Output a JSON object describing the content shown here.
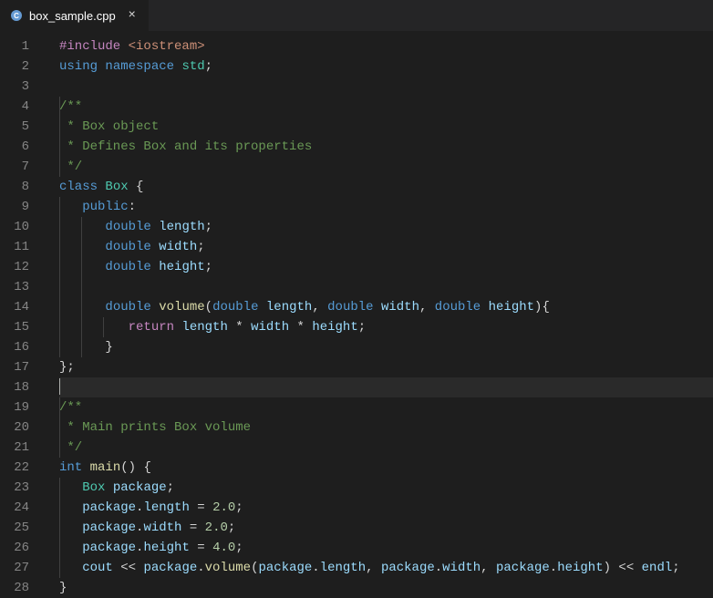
{
  "tab": {
    "filename": "box_sample.cpp",
    "close_glyph": "×"
  },
  "editor": {
    "current_line": 18,
    "lines": [
      {
        "n": 1,
        "indent": 0,
        "tokens": [
          {
            "t": "#include ",
            "c": "directive"
          },
          {
            "t": "<iostream>",
            "c": "header"
          }
        ]
      },
      {
        "n": 2,
        "indent": 0,
        "tokens": [
          {
            "t": "using",
            "c": "keyword"
          },
          {
            "t": " ",
            "c": "plain"
          },
          {
            "t": "namespace",
            "c": "keyword"
          },
          {
            "t": " ",
            "c": "plain"
          },
          {
            "t": "std",
            "c": "namespace"
          },
          {
            "t": ";",
            "c": "punc"
          }
        ]
      },
      {
        "n": 3,
        "indent": 0,
        "tokens": []
      },
      {
        "n": 4,
        "indent": 0,
        "guides": [
          0
        ],
        "tokens": [
          {
            "t": "/**",
            "c": "comment"
          }
        ]
      },
      {
        "n": 5,
        "indent": 0,
        "guides": [
          0
        ],
        "tokens": [
          {
            "t": " * Box object",
            "c": "comment"
          }
        ]
      },
      {
        "n": 6,
        "indent": 0,
        "guides": [
          0
        ],
        "tokens": [
          {
            "t": " * Defines Box and its properties",
            "c": "comment"
          }
        ]
      },
      {
        "n": 7,
        "indent": 0,
        "guides": [
          0
        ],
        "tokens": [
          {
            "t": " */",
            "c": "comment"
          }
        ]
      },
      {
        "n": 8,
        "indent": 0,
        "tokens": [
          {
            "t": "class",
            "c": "keyword"
          },
          {
            "t": " ",
            "c": "plain"
          },
          {
            "t": "Box",
            "c": "class"
          },
          {
            "t": " {",
            "c": "punc"
          }
        ]
      },
      {
        "n": 9,
        "indent": 1,
        "guides": [
          0
        ],
        "tokens": [
          {
            "t": "public",
            "c": "keyword"
          },
          {
            "t": ":",
            "c": "punc"
          }
        ]
      },
      {
        "n": 10,
        "indent": 2,
        "guides": [
          0,
          1
        ],
        "tokens": [
          {
            "t": "double",
            "c": "type"
          },
          {
            "t": " ",
            "c": "plain"
          },
          {
            "t": "length",
            "c": "var"
          },
          {
            "t": ";",
            "c": "punc"
          }
        ]
      },
      {
        "n": 11,
        "indent": 2,
        "guides": [
          0,
          1
        ],
        "tokens": [
          {
            "t": "double",
            "c": "type"
          },
          {
            "t": " ",
            "c": "plain"
          },
          {
            "t": "width",
            "c": "var"
          },
          {
            "t": ";",
            "c": "punc"
          }
        ]
      },
      {
        "n": 12,
        "indent": 2,
        "guides": [
          0,
          1
        ],
        "tokens": [
          {
            "t": "double",
            "c": "type"
          },
          {
            "t": " ",
            "c": "plain"
          },
          {
            "t": "height",
            "c": "var"
          },
          {
            "t": ";",
            "c": "punc"
          }
        ]
      },
      {
        "n": 13,
        "indent": 0,
        "guides": [
          0,
          1
        ],
        "tokens": []
      },
      {
        "n": 14,
        "indent": 2,
        "guides": [
          0,
          1
        ],
        "tokens": [
          {
            "t": "double",
            "c": "type"
          },
          {
            "t": " ",
            "c": "plain"
          },
          {
            "t": "volume",
            "c": "func"
          },
          {
            "t": "(",
            "c": "punc"
          },
          {
            "t": "double",
            "c": "type"
          },
          {
            "t": " ",
            "c": "plain"
          },
          {
            "t": "length",
            "c": "var"
          },
          {
            "t": ", ",
            "c": "punc"
          },
          {
            "t": "double",
            "c": "type"
          },
          {
            "t": " ",
            "c": "plain"
          },
          {
            "t": "width",
            "c": "var"
          },
          {
            "t": ", ",
            "c": "punc"
          },
          {
            "t": "double",
            "c": "type"
          },
          {
            "t": " ",
            "c": "plain"
          },
          {
            "t": "height",
            "c": "var"
          },
          {
            "t": "){",
            "c": "punc"
          }
        ]
      },
      {
        "n": 15,
        "indent": 3,
        "guides": [
          0,
          1,
          2
        ],
        "tokens": [
          {
            "t": "return",
            "c": "directive"
          },
          {
            "t": " ",
            "c": "plain"
          },
          {
            "t": "length",
            "c": "var"
          },
          {
            "t": " * ",
            "c": "op"
          },
          {
            "t": "width",
            "c": "var"
          },
          {
            "t": " * ",
            "c": "op"
          },
          {
            "t": "height",
            "c": "var"
          },
          {
            "t": ";",
            "c": "punc"
          }
        ]
      },
      {
        "n": 16,
        "indent": 2,
        "guides": [
          0,
          1
        ],
        "tokens": [
          {
            "t": "}",
            "c": "punc"
          }
        ]
      },
      {
        "n": 17,
        "indent": 0,
        "tokens": [
          {
            "t": "};",
            "c": "punc"
          }
        ]
      },
      {
        "n": 18,
        "indent": 0,
        "cursor": true,
        "tokens": []
      },
      {
        "n": 19,
        "indent": 0,
        "guides": [
          0
        ],
        "tokens": [
          {
            "t": "/**",
            "c": "comment"
          }
        ]
      },
      {
        "n": 20,
        "indent": 0,
        "guides": [
          0
        ],
        "tokens": [
          {
            "t": " * Main prints Box volume",
            "c": "comment"
          }
        ]
      },
      {
        "n": 21,
        "indent": 0,
        "guides": [
          0
        ],
        "tokens": [
          {
            "t": " */",
            "c": "comment"
          }
        ]
      },
      {
        "n": 22,
        "indent": 0,
        "tokens": [
          {
            "t": "int",
            "c": "type"
          },
          {
            "t": " ",
            "c": "plain"
          },
          {
            "t": "main",
            "c": "func"
          },
          {
            "t": "() {",
            "c": "punc"
          }
        ]
      },
      {
        "n": 23,
        "indent": 1,
        "guides": [
          0
        ],
        "tokens": [
          {
            "t": "Box",
            "c": "class"
          },
          {
            "t": " ",
            "c": "plain"
          },
          {
            "t": "package",
            "c": "var"
          },
          {
            "t": ";",
            "c": "punc"
          }
        ]
      },
      {
        "n": 24,
        "indent": 1,
        "guides": [
          0
        ],
        "tokens": [
          {
            "t": "package",
            "c": "var"
          },
          {
            "t": ".",
            "c": "punc"
          },
          {
            "t": "length",
            "c": "var"
          },
          {
            "t": " = ",
            "c": "op"
          },
          {
            "t": "2.0",
            "c": "num"
          },
          {
            "t": ";",
            "c": "punc"
          }
        ]
      },
      {
        "n": 25,
        "indent": 1,
        "guides": [
          0
        ],
        "tokens": [
          {
            "t": "package",
            "c": "var"
          },
          {
            "t": ".",
            "c": "punc"
          },
          {
            "t": "width",
            "c": "var"
          },
          {
            "t": " = ",
            "c": "op"
          },
          {
            "t": "2.0",
            "c": "num"
          },
          {
            "t": ";",
            "c": "punc"
          }
        ]
      },
      {
        "n": 26,
        "indent": 1,
        "guides": [
          0
        ],
        "tokens": [
          {
            "t": "package",
            "c": "var"
          },
          {
            "t": ".",
            "c": "punc"
          },
          {
            "t": "height",
            "c": "var"
          },
          {
            "t": " = ",
            "c": "op"
          },
          {
            "t": "4.0",
            "c": "num"
          },
          {
            "t": ";",
            "c": "punc"
          }
        ]
      },
      {
        "n": 27,
        "indent": 1,
        "guides": [
          0
        ],
        "tokens": [
          {
            "t": "cout",
            "c": "var"
          },
          {
            "t": " << ",
            "c": "op"
          },
          {
            "t": "package",
            "c": "var"
          },
          {
            "t": ".",
            "c": "punc"
          },
          {
            "t": "volume",
            "c": "func"
          },
          {
            "t": "(",
            "c": "punc"
          },
          {
            "t": "package",
            "c": "var"
          },
          {
            "t": ".",
            "c": "punc"
          },
          {
            "t": "length",
            "c": "var"
          },
          {
            "t": ", ",
            "c": "punc"
          },
          {
            "t": "package",
            "c": "var"
          },
          {
            "t": ".",
            "c": "punc"
          },
          {
            "t": "width",
            "c": "var"
          },
          {
            "t": ", ",
            "c": "punc"
          },
          {
            "t": "package",
            "c": "var"
          },
          {
            "t": ".",
            "c": "punc"
          },
          {
            "t": "height",
            "c": "var"
          },
          {
            "t": ") << ",
            "c": "op"
          },
          {
            "t": "endl",
            "c": "var"
          },
          {
            "t": ";",
            "c": "punc"
          }
        ]
      },
      {
        "n": 28,
        "indent": 0,
        "tokens": [
          {
            "t": "}",
            "c": "punc"
          }
        ]
      }
    ]
  }
}
